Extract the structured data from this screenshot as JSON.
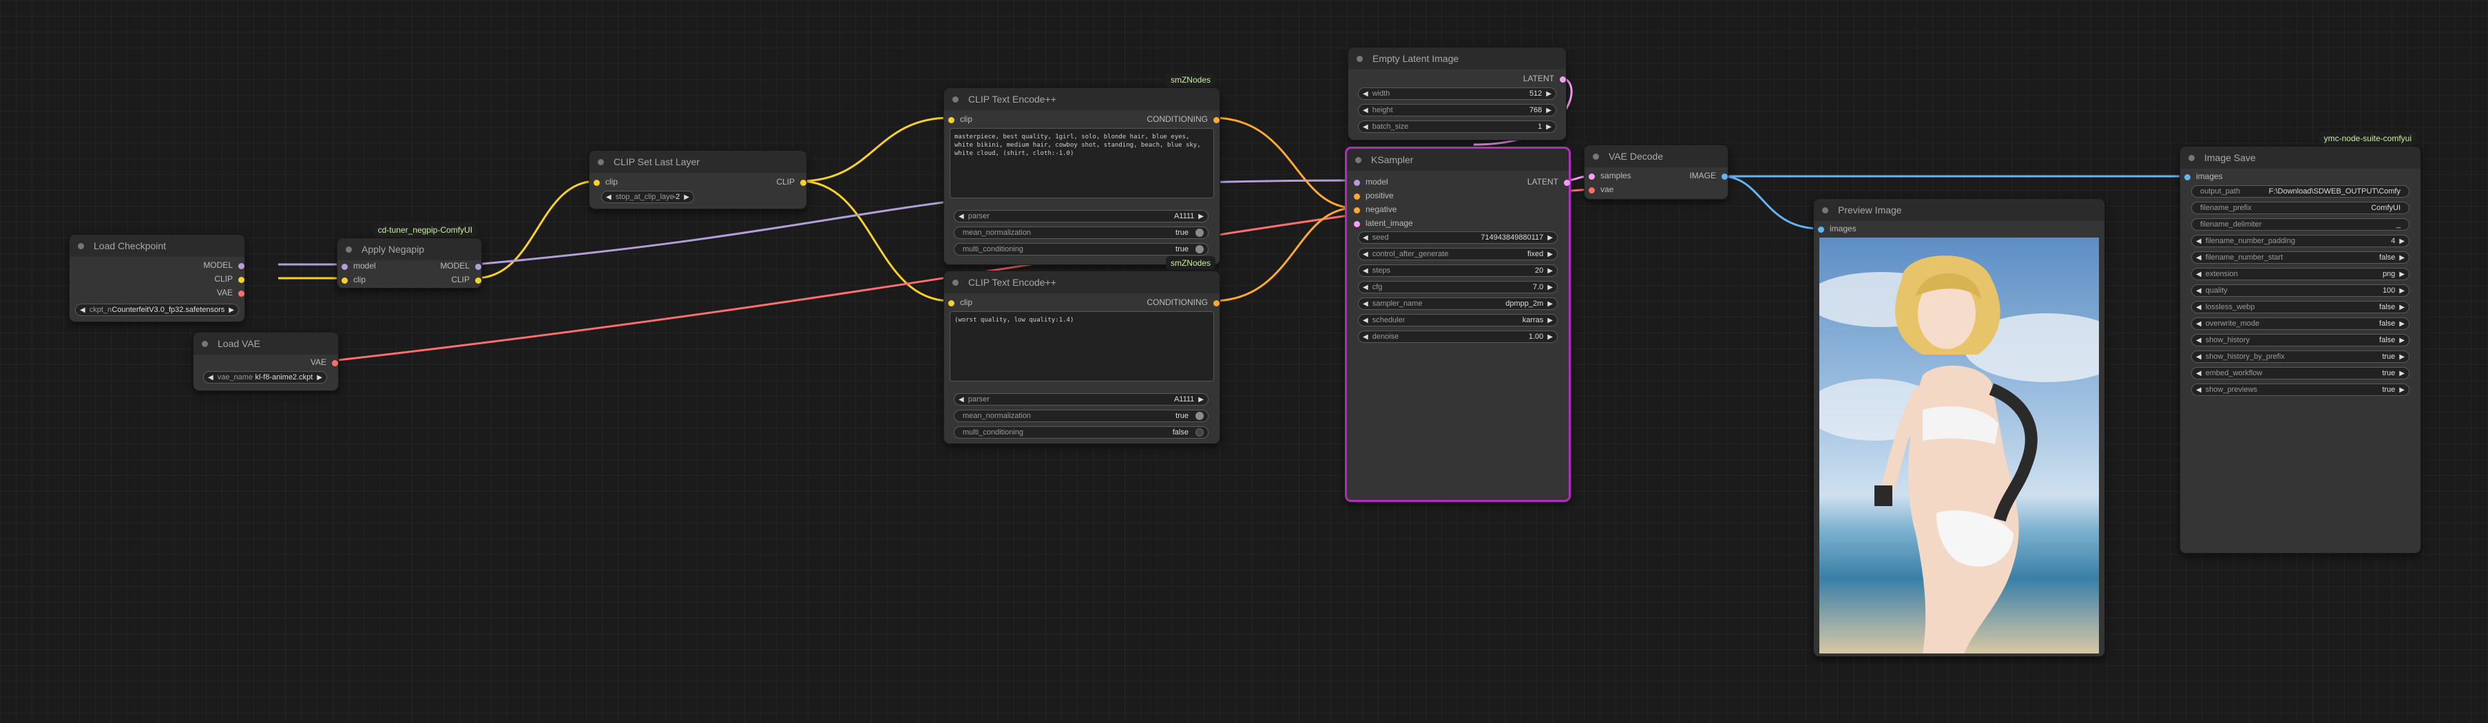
{
  "colors": {
    "clip": "#f7d12a",
    "model": "#b39ddb",
    "vae": "#ff6e6e",
    "latent": "#ff9cf9",
    "image": "#64b5f6",
    "conditioning": "#ffa931",
    "selected": "#b52bc1"
  },
  "load_checkpoint": {
    "title": "Load Checkpoint",
    "outputs": [
      "MODEL",
      "CLIP",
      "VAE"
    ],
    "ckpt_label": "ckpt_name",
    "ckpt_value": "CounterfeitV3.0_fp32.safetensors"
  },
  "apply_negpip": {
    "badge": "cd-tuner_negpip-ComfyUI",
    "title": "Apply Negapip",
    "inputs": [
      "model",
      "clip"
    ],
    "outputs": [
      "MODEL",
      "CLIP"
    ]
  },
  "load_vae": {
    "title": "Load VAE",
    "output": "VAE",
    "vae_label": "vae_name",
    "vae_value": "kl-f8-anime2.ckpt"
  },
  "clip_set_last_layer": {
    "title": "CLIP Set Last Layer",
    "input": "clip",
    "output": "CLIP",
    "widget_label": "stop_at_clip_layer",
    "widget_value": "-2"
  },
  "clip_encode_pos": {
    "badge": "smZNodes",
    "title": "CLIP Text Encode++",
    "input": "clip",
    "output": "CONDITIONING",
    "text": "masterpiece, best quality, 1girl, solo, blonde hair, blue eyes, white bikini, medium hair, cowboy shot, standing, beach, blue sky, white cloud, (shirt, cloth:-1.0)",
    "parser_label": "parser",
    "parser_value": "A1111",
    "mean_label": "mean_normalization",
    "mean_value": "true",
    "multi_label": "multi_conditioning",
    "multi_value": "true"
  },
  "clip_encode_neg": {
    "badge": "smZNodes",
    "title": "CLIP Text Encode++",
    "input": "clip",
    "output": "CONDITIONING",
    "text": "(worst quality, low quality:1.4)",
    "parser_label": "parser",
    "parser_value": "A1111",
    "mean_label": "mean_normalization",
    "mean_value": "true",
    "multi_label": "multi_conditioning",
    "multi_value": "false"
  },
  "empty_latent": {
    "title": "Empty Latent Image",
    "output": "LATENT",
    "widgets": [
      {
        "label": "width",
        "value": "512"
      },
      {
        "label": "height",
        "value": "768"
      },
      {
        "label": "batch_size",
        "value": "1"
      }
    ]
  },
  "ksampler": {
    "title": "KSampler",
    "inputs": [
      "model",
      "positive",
      "negative",
      "latent_image"
    ],
    "output": "LATENT",
    "widgets": [
      {
        "label": "seed",
        "value": "714943849880117"
      },
      {
        "label": "control_after_generate",
        "value": "fixed"
      },
      {
        "label": "steps",
        "value": "20"
      },
      {
        "label": "cfg",
        "value": "7.0"
      },
      {
        "label": "sampler_name",
        "value": "dpmpp_2m"
      },
      {
        "label": "scheduler",
        "value": "karras"
      },
      {
        "label": "denoise",
        "value": "1.00"
      }
    ]
  },
  "vae_decode": {
    "title": "VAE Decode",
    "inputs": [
      "samples",
      "vae"
    ],
    "output": "IMAGE"
  },
  "preview_image": {
    "title": "Preview Image",
    "input": "images"
  },
  "image_save": {
    "badge": "ymc-node-suite-comfyui",
    "title": "Image Save",
    "input": "images",
    "widgets": [
      {
        "label": "output_path",
        "value": "F:\\Download\\SDWEB_OUTPUT\\Comfy"
      },
      {
        "label": "filename_prefix",
        "value": "ComfyUI"
      },
      {
        "label": "filename_delimiter",
        "value": "_"
      },
      {
        "label": "filename_number_padding",
        "value": "4"
      },
      {
        "label": "filename_number_start",
        "value": "false"
      },
      {
        "label": "extension",
        "value": "png"
      },
      {
        "label": "quality",
        "value": "100"
      },
      {
        "label": "lossless_webp",
        "value": "false"
      },
      {
        "label": "overwrite_mode",
        "value": "false"
      },
      {
        "label": "show_history",
        "value": "false"
      },
      {
        "label": "show_history_by_prefix",
        "value": "true"
      },
      {
        "label": "embed_workflow",
        "value": "true"
      },
      {
        "label": "show_previews",
        "value": "true"
      }
    ]
  }
}
